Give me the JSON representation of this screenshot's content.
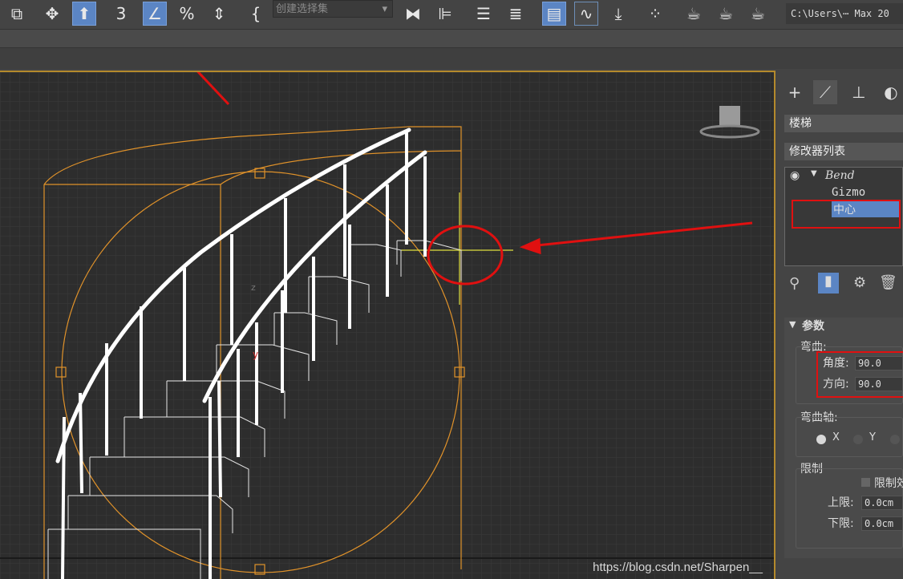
{
  "toolbar": {
    "selection_set_placeholder": "创建选择集",
    "path_text": "C:\\Users\\⋯  Max 20"
  },
  "icons": [
    "select-link-icon",
    "move-icon",
    "select-object-icon",
    "snap-3d-icon",
    "angle-snap-icon",
    "percent-snap-icon",
    "spinner-snap-icon",
    "edit-named-selection-icon",
    "mirror-icon",
    "align-icon",
    "layer-explorer-icon",
    "layers-icon",
    "toggle-scene-explorer-icon",
    "curve-editor-icon",
    "schematic-view-icon",
    "material-editor-icon",
    "render-setup-icon",
    "rendered-frame-icon",
    "render-icon"
  ],
  "viewport": {
    "axis_z": "z",
    "axis_y": "y",
    "watermark": "https://blog.csdn.net/Sharpen__"
  },
  "panel": {
    "object_name": "楼梯",
    "modifier_list_label": "修改器列表",
    "stack": {
      "modifier": "Bend",
      "sub1": "Gizmo",
      "sub2": "中心"
    },
    "rollout_title": "参数",
    "bend_label": "弯曲:",
    "angle_label": "角度:",
    "angle_value": "90.0",
    "direction_label": "方向:",
    "direction_value": "90.0",
    "bend_axis_label": "弯曲轴:",
    "axis_x": "X",
    "axis_y": "Y",
    "selected_axis": "X",
    "limits_label": "限制",
    "limit_effect_label": "限制效",
    "upper_label": "上限:",
    "upper_value": "0.0cm",
    "lower_label": "下限:",
    "lower_value": "0.0cm"
  },
  "colors": {
    "active_blue": "#5b85c4",
    "highlight_red": "#e01010",
    "gizmo_orange": "#e0922a",
    "viewport_bg": "#2d2d2d"
  }
}
